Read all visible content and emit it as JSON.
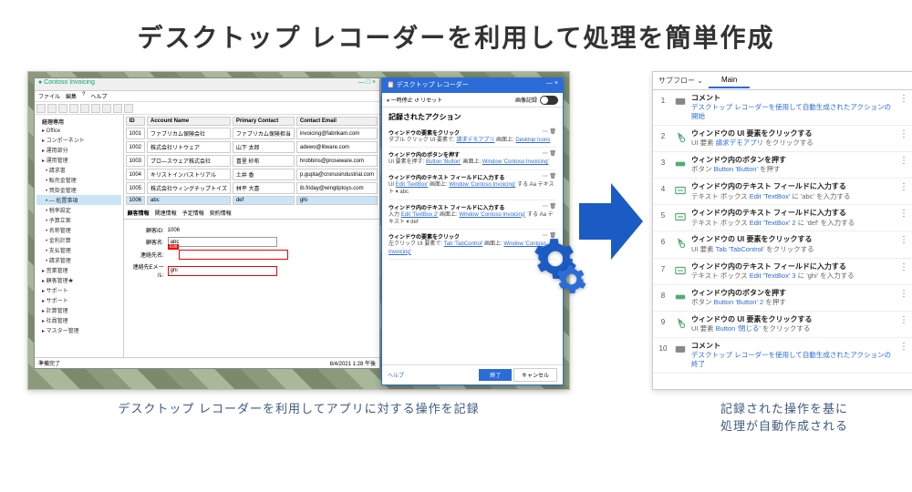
{
  "title": "デスクトップ レコーダーを利用して処理を簡単作成",
  "caption_left": "デスクトップ レコーダーを利用してアプリに対する操作を記録",
  "caption_right_1": "記録された操作を基に",
  "caption_right_2": "処理が自動作成される",
  "app": {
    "title": "Contoso Invoicing",
    "close": "×",
    "menu": [
      "ファイル",
      "編集",
      "?",
      "ヘルプ"
    ],
    "tree_root": "経理専用",
    "tree": [
      "Office",
      "コンポーネント",
      "運用部分",
      "運用管理",
      "請求書",
      "販売金管理",
      "買掛金管理",
      "— 処置事項",
      "税率設定",
      "予算立案",
      "名称管理",
      "金利計算",
      "支払管理",
      "請求管理",
      "営業管理",
      "顧客管理★",
      "サポート",
      "サポート",
      "計算管理",
      "社員管理",
      "マスター管理"
    ],
    "grid_headers": [
      "ID",
      "Account Name",
      "Primary Contact",
      "Contact Email"
    ],
    "grid_rows": [
      [
        "1001",
        "ファブリカム保険会社",
        "ファブリカム保険担当",
        "invoicing@fabrikam.com"
      ],
      [
        "1002",
        "株式会社リトウェア",
        "山下 太郎",
        "adewo@litware.com"
      ],
      [
        "1003",
        "プロ―スウェア株式会社",
        "喜里 紗布",
        "hrobbins@proseware.com"
      ],
      [
        "1004",
        "キリストインバストリアル",
        "土井 香",
        "p.gupta@cronusindustrial.com"
      ],
      [
        "1005",
        "株式会社ウィングチップトイズ",
        "林平 大喜",
        "ib.friday@wingtiptoys.com"
      ],
      [
        "1006",
        "abc",
        "def",
        "ghi"
      ]
    ],
    "grid_sel_row": 5,
    "form_tabs": [
      "顧客情報",
      "関連情報",
      "予定情報",
      "契約情報"
    ],
    "form": {
      "id_label": "顧客ID:",
      "id_val": "1006",
      "name_label": "顧客名:",
      "name_val": "abc",
      "contact_label": "連絡先名:",
      "contact_val": "",
      "contact_hint": "Edit",
      "email_label": "連絡先Eメール:",
      "email_val": "ghi"
    },
    "status_left": "準備完了",
    "status_right": "8/4/2021  1:28 午後"
  },
  "recorder": {
    "title": "デスクトップ レコーダー",
    "pause": "一時停止",
    "reset": "リセット",
    "imgrec": "画像記録",
    "heading": "記録されたアクション",
    "actions": [
      {
        "t": "ウィンドウの要素をクリック",
        "d": "ダブル クリック UI 要素で: 請求デモアプリ 画面上: Desktop Icons"
      },
      {
        "t": "ウィンドウ内のボタンを押す",
        "d": "UI 要素を押す: Button 'Button' 画面上: Window 'Contoso Invoicing'"
      },
      {
        "t": "ウィンドウ内のテキスト フィールドに入力する",
        "d": "UI Edit 'TextBox' 画面上: Window 'Contoso Invoicing' する  Aa テキスト ▾  abc"
      },
      {
        "t": "ウィンドウ内のテキスト フィールドに入力する",
        "d": "入力 Edit 'TextBox 2' 画面上: Window 'Contoso Invoicing' する  Aa テキスト ▾  def"
      },
      {
        "t": "ウィンドウの要素をクリック",
        "d": "左クリック UI 要素で: Tab 'TabControl' 画面上: Window 'Contoso Invoicing'"
      }
    ],
    "help": "ヘルプ",
    "finish": "終了",
    "cancel": "キャンセル"
  },
  "flow": {
    "subflow": "サブフロー",
    "main": "Main",
    "items": [
      {
        "n": 1,
        "ic": "comment",
        "t": "コメント",
        "d": "デスクトップ レコーダーを使用して自動生成されたアクションの開始",
        "dlink": true
      },
      {
        "n": 2,
        "ic": "click",
        "t": "ウィンドウの UI 要素をクリックする",
        "d": "UI 要素 請求デモアプリ をクリックする"
      },
      {
        "n": 3,
        "ic": "button",
        "t": "ウィンドウ内のボタンを押す",
        "d": "ボタン Button 'Button' を押す"
      },
      {
        "n": 4,
        "ic": "text",
        "t": "ウィンドウ内のテキスト フィールドに入力する",
        "d": "テキスト ボックス Edit 'TextBox' に 'abc' を入力する"
      },
      {
        "n": 5,
        "ic": "text",
        "t": "ウィンドウ内のテキスト フィールドに入力する",
        "d": "テキスト ボックス Edit 'TextBox' 2 に 'def' を入力する"
      },
      {
        "n": 6,
        "ic": "click",
        "t": "ウィンドウの UI 要素をクリックする",
        "d": "UI 要素 Tab 'TabControl' をクリックする"
      },
      {
        "n": 7,
        "ic": "text",
        "t": "ウィンドウ内のテキスト フィールドに入力する",
        "d": "テキスト ボックス Edit 'TextBox' 3 に 'ghi' を入力する"
      },
      {
        "n": 8,
        "ic": "button",
        "t": "ウィンドウ内のボタンを押す",
        "d": "ボタン Button 'Button' 2 を押す"
      },
      {
        "n": 9,
        "ic": "click",
        "t": "ウィンドウの UI 要素をクリックする",
        "d": "UI 要素 Button '閉じる' をクリックする"
      },
      {
        "n": 10,
        "ic": "comment",
        "t": "コメント",
        "d": "デスクトップ レコーダーを使用して自動生成されたアクションの終了",
        "dlink": true
      }
    ]
  }
}
